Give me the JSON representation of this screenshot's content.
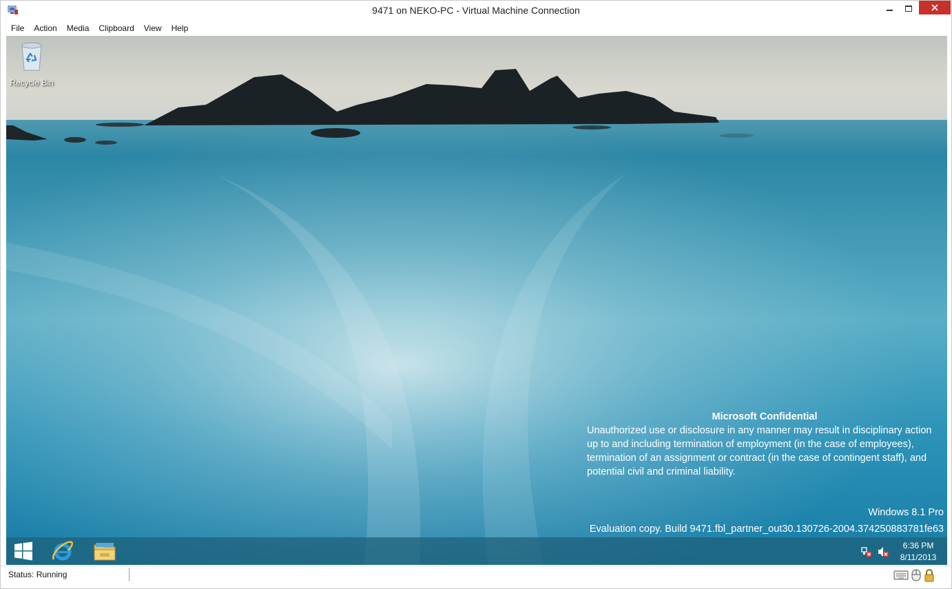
{
  "window": {
    "title": "9471 on NEKO-PC - Virtual Machine Connection"
  },
  "menu": [
    "File",
    "Action",
    "Media",
    "Clipboard",
    "View",
    "Help"
  ],
  "desktop": {
    "icons": [
      {
        "label": "Recycle Bin",
        "icon": "recycle-bin-icon"
      }
    ],
    "watermark": {
      "title": "Microsoft Confidential",
      "body": "Unauthorized use or disclosure in any manner may result in disciplinary action up to and including termination of employment (in the case of employees), termination of an assignment or contract (in the case of contingent staff), and potential civil and criminal liability.",
      "edition": "Windows 8.1 Pro",
      "build": "Evaluation copy. Build 9471.fbl_partner_out30.130726-2004.374250883781fe63"
    }
  },
  "taskbar": {
    "pinned": [
      "windows-start-icon",
      "internet-explorer-icon",
      "file-explorer-icon"
    ],
    "tray": [
      "network-disconnected-icon",
      "volume-muted-icon"
    ],
    "time": "6:36 PM",
    "date": "8/11/2013"
  },
  "status": {
    "text": "Status: Running"
  },
  "status_icons": [
    "keyboard-icon",
    "mouse-icon",
    "lock-icon"
  ],
  "colors": {
    "close_button": "#c7302b",
    "taskbar": "#1e5f78"
  }
}
